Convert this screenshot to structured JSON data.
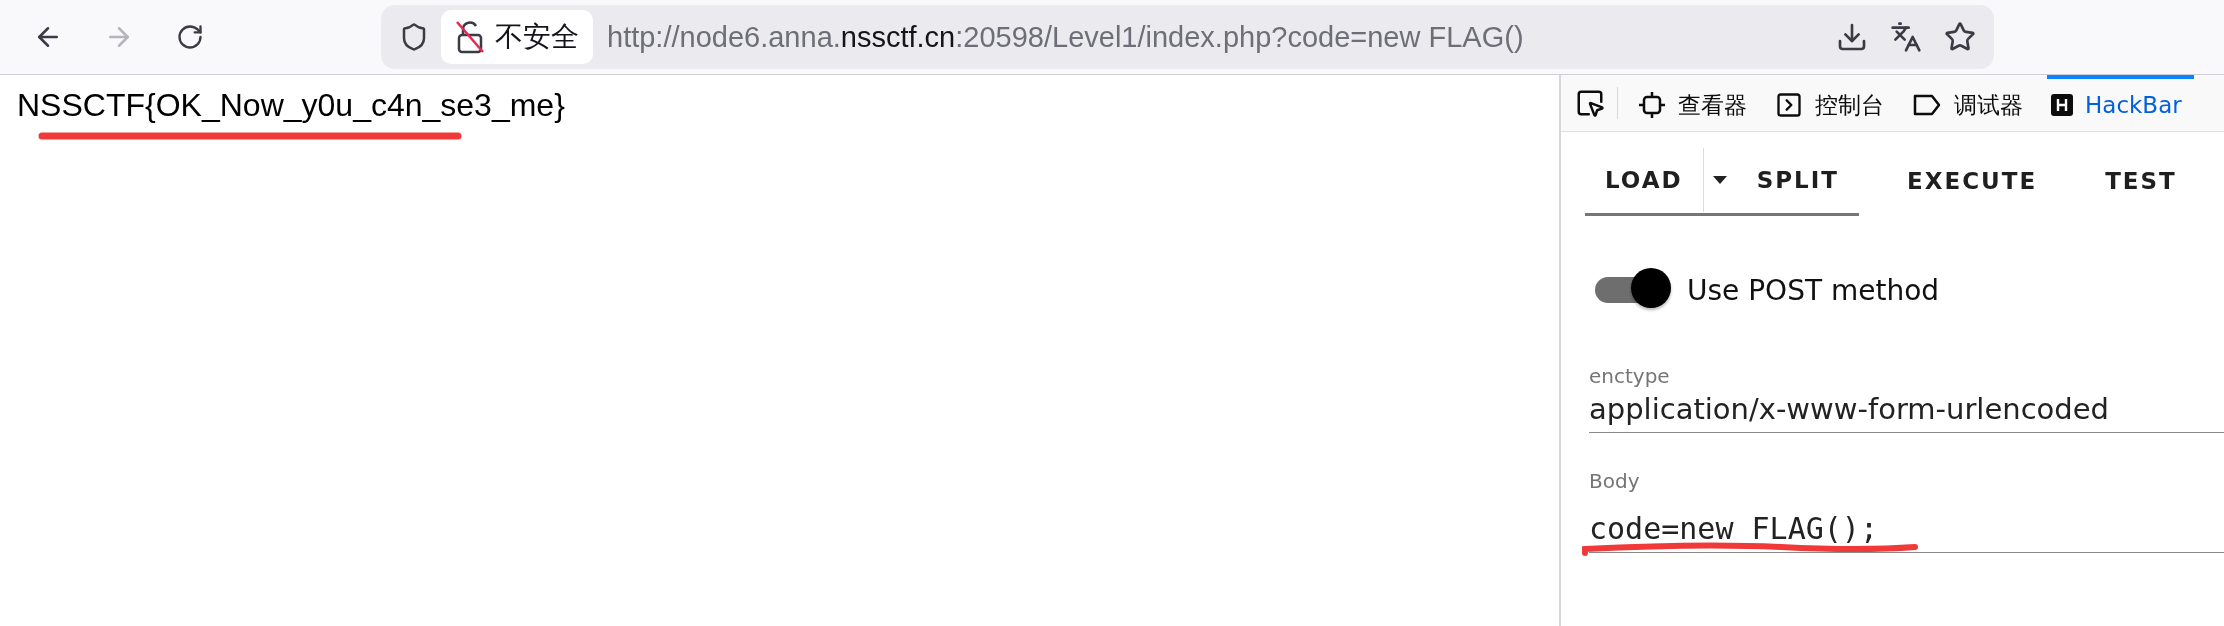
{
  "toolbar": {
    "nav_buttons": [
      {
        "kind": "back",
        "disabled": false
      },
      {
        "kind": "forward",
        "disabled": true
      },
      {
        "kind": "reload",
        "disabled": false
      }
    ],
    "address_bar": {
      "security_label": "不安全",
      "url_parts": [
        {
          "text": "http://node6.anna.",
          "emphasis": false
        },
        {
          "text": "nssctf.cn",
          "emphasis": true
        },
        {
          "text": ":20598/Level1/index.php?code=new FLAG()",
          "emphasis": false
        }
      ]
    }
  },
  "page": {
    "text": "NSSCTF{OK_Now_y0u_c4n_se3_me}"
  },
  "devtools": {
    "tabs": [
      {
        "kind": "inspector",
        "label": "查看器",
        "selected": false
      },
      {
        "kind": "console",
        "label": "控制台",
        "selected": false
      },
      {
        "kind": "debugger",
        "label": "调试器",
        "selected": false
      },
      {
        "kind": "hackbar",
        "label": "HackBar",
        "selected": true
      }
    ]
  },
  "hackbar": {
    "buttons": [
      {
        "kind": "load",
        "label": "LOAD"
      },
      {
        "kind": "split",
        "label": "SPLIT"
      },
      {
        "kind": "execute",
        "label": "EXECUTE"
      },
      {
        "kind": "test",
        "label": "TEST"
      }
    ],
    "post_toggle": {
      "label": "Use POST method",
      "on": true
    },
    "fields": [
      {
        "kind": "text",
        "label": "enctype",
        "value": "application/x-www-form-urlencoded"
      },
      {
        "kind": "code",
        "label": "Body",
        "value": "code=new FLAG();"
      }
    ]
  }
}
